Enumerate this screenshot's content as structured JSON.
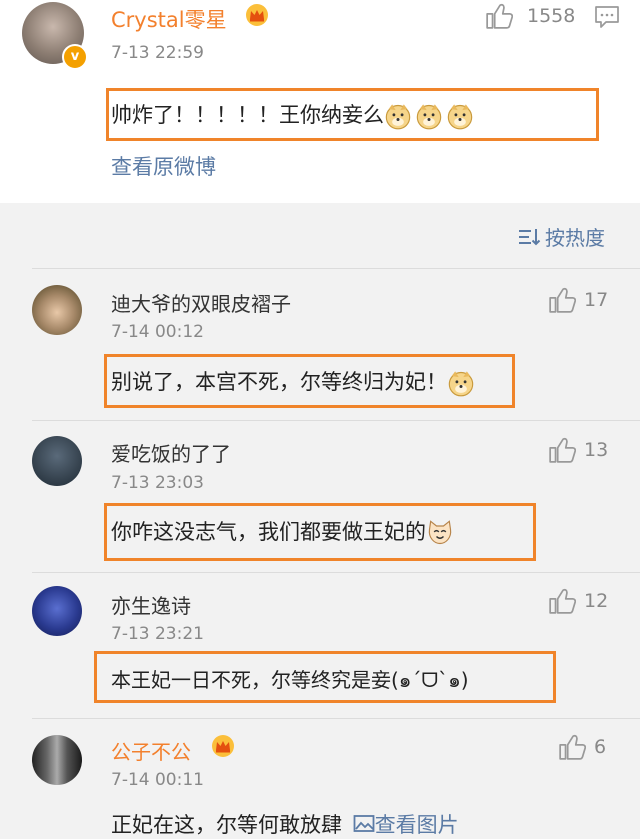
{
  "main_post": {
    "username": "Crystal零星",
    "time": "7-13 22:59",
    "likes": "1558",
    "text": "帅炸了！！！！！王你纳妾么",
    "view_original_link": "查看原微博"
  },
  "sort_label": "按热度",
  "replies": [
    {
      "username": "迪大爷的双眼皮褶子",
      "time": "7-14 00:12",
      "likes": "17",
      "text": "别说了，本宫不死，尔等终归为妃！"
    },
    {
      "username": "爱吃饭的了了",
      "time": "7-13 23:03",
      "likes": "13",
      "text": "你咋这没志气，我们都要做王妃的"
    },
    {
      "username": "亦生逸诗",
      "time": "7-13 23:21",
      "likes": "12",
      "text": "本王妃一日不死，尔等终究是妾(๑´ᗜ`๑)"
    },
    {
      "username": "公子不公",
      "time": "7-14 00:11",
      "likes": "6",
      "text": "正妃在这，尔等何敢放肆",
      "image_link": "查看图片"
    }
  ],
  "colors": {
    "highlight_box": "#f0842a",
    "vip_name": "#f3802d",
    "link": "#5b7ba5"
  },
  "icons": [
    "thumb-up-icon",
    "comment-icon",
    "vip-crown-icon",
    "verified-badge-icon",
    "doge-emoji",
    "cat-emoji",
    "sort-icon",
    "image-icon"
  ]
}
